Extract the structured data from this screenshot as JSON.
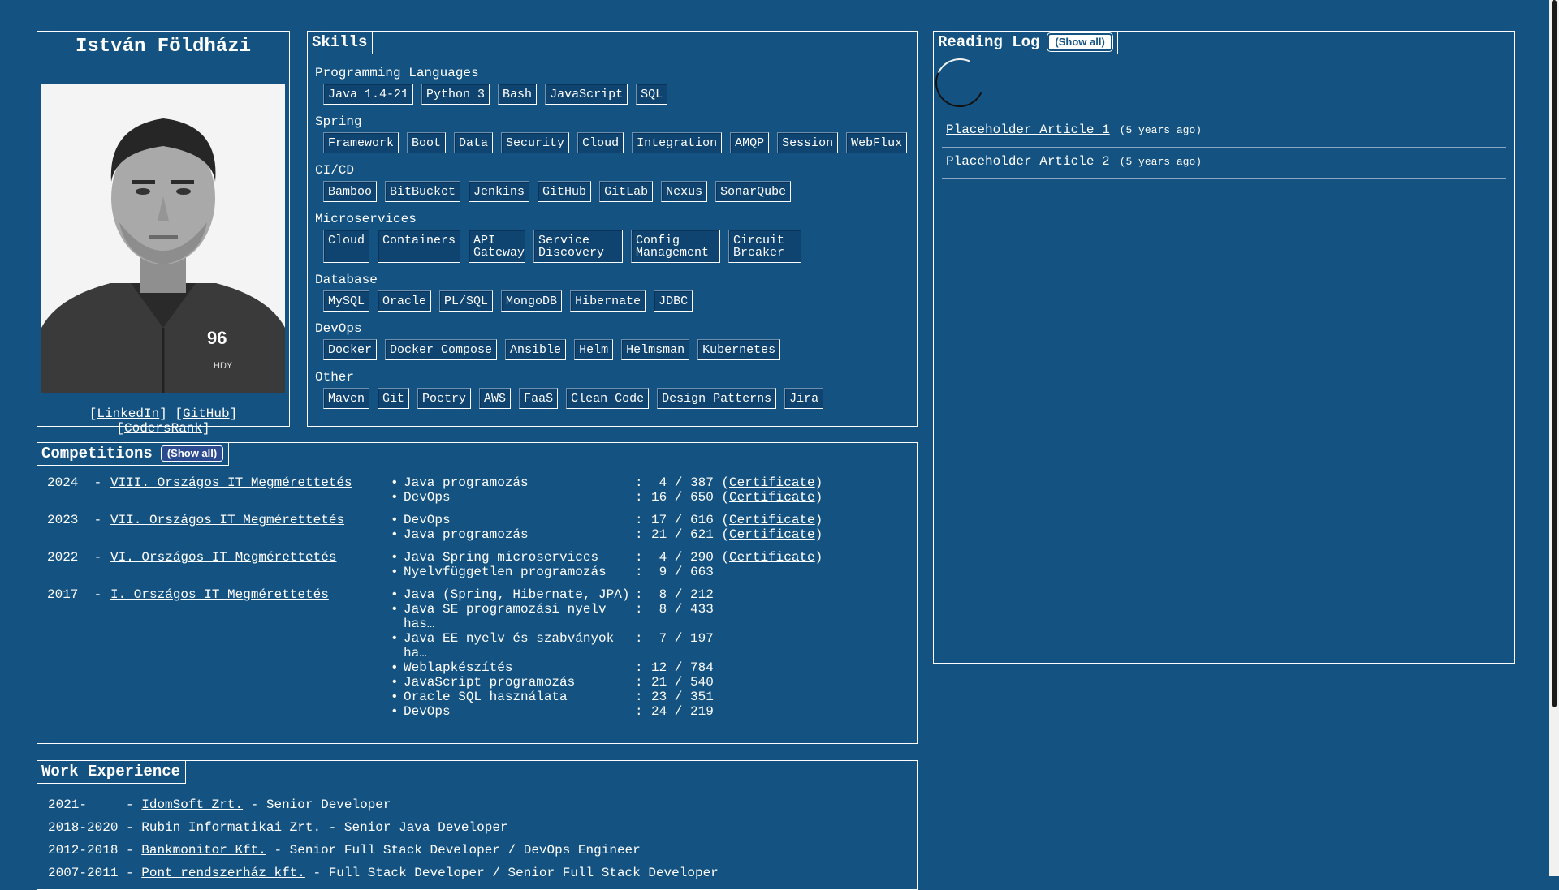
{
  "profile": {
    "name": "István Földházi",
    "photo_text": "96",
    "photo_subtext": "HDY",
    "links": [
      {
        "label": "LinkedIn"
      },
      {
        "label": "GitHub"
      },
      {
        "label": "CodersRank"
      }
    ]
  },
  "skills": {
    "title": "Skills",
    "groups": [
      {
        "name": "Programming Languages",
        "items": [
          "Java 1.4-21",
          "Python 3",
          "Bash",
          "JavaScript",
          "SQL"
        ]
      },
      {
        "name": "Spring",
        "items": [
          "Framework",
          "Boot",
          "Data",
          "Security",
          "Cloud",
          "Integration",
          "AMQP",
          "Session",
          "WebFlux"
        ]
      },
      {
        "name": "CI/CD",
        "items": [
          "Bamboo",
          "BitBucket",
          "Jenkins",
          "GitHub",
          "GitLab",
          "Nexus",
          "SonarQube"
        ]
      },
      {
        "name": "Microservices",
        "items": [
          "Cloud",
          "Containers",
          "API Gateway",
          "Service Discovery",
          "Config Management",
          "Circuit Breaker"
        ]
      },
      {
        "name": "Database",
        "items": [
          "MySQL",
          "Oracle",
          "PL/SQL",
          "MongoDB",
          "Hibernate",
          "JDBC"
        ]
      },
      {
        "name": "DevOps",
        "items": [
          "Docker",
          "Docker Compose",
          "Ansible",
          "Helm",
          "Helmsman",
          "Kubernetes"
        ]
      },
      {
        "name": "Other",
        "items": [
          "Maven",
          "Git",
          "Poetry",
          "AWS",
          "FaaS",
          "Clean Code",
          "Design Patterns",
          "Jira"
        ]
      }
    ]
  },
  "reading_log": {
    "title": "Reading Log",
    "show_all": "(Show all)",
    "articles": [
      {
        "title": "Placeholder Article 1",
        "ago": "(5 years ago)"
      },
      {
        "title": "Placeholder Article 2",
        "ago": "(5 years ago)"
      }
    ]
  },
  "competitions": {
    "title": "Competitions",
    "show_all": "(Show all)",
    "entries": [
      {
        "year": "2024",
        "name": "VIII. Országos IT Megmérettetés",
        "results": [
          {
            "title": "Java programozás",
            "rank": "4",
            "total": "387",
            "certificate": "Certificate"
          },
          {
            "title": "DevOps",
            "rank": "16",
            "total": "650",
            "certificate": "Certificate"
          }
        ]
      },
      {
        "year": "2023",
        "name": "VII. Országos IT Megmérettetés",
        "results": [
          {
            "title": "DevOps",
            "rank": "17",
            "total": "616",
            "certificate": "Certificate"
          },
          {
            "title": "Java programozás",
            "rank": "21",
            "total": "621",
            "certificate": "Certificate"
          }
        ]
      },
      {
        "year": "2022",
        "name": "VI. Országos IT Megmérettetés",
        "results": [
          {
            "title": "Java Spring microservices",
            "rank": "4",
            "total": "290",
            "certificate": "Certificate"
          },
          {
            "title": "Nyelvfüggetlen programozás",
            "rank": "9",
            "total": "663",
            "certificate": ""
          }
        ]
      },
      {
        "year": "2017",
        "name": "I. Országos IT Megmérettetés",
        "results": [
          {
            "title": "Java (Spring, Hibernate, JPA)",
            "rank": "8",
            "total": "212",
            "certificate": ""
          },
          {
            "title": "Java SE programozási nyelv has…",
            "rank": "8",
            "total": "433",
            "certificate": ""
          },
          {
            "title": "Java EE nyelv és szabványok ha…",
            "rank": "7",
            "total": "197",
            "certificate": ""
          },
          {
            "title": "Weblapkészítés",
            "rank": "12",
            "total": "784",
            "certificate": ""
          },
          {
            "title": "JavaScript programozás",
            "rank": "21",
            "total": "540",
            "certificate": ""
          },
          {
            "title": "Oracle SQL használata",
            "rank": "23",
            "total": "351",
            "certificate": ""
          },
          {
            "title": "DevOps",
            "rank": "24",
            "total": "219",
            "certificate": ""
          }
        ]
      }
    ]
  },
  "work": {
    "title": "Work Experience",
    "entries": [
      {
        "period": "2021-    ",
        "company": "IdomSoft Zrt.",
        "role": "Senior Developer"
      },
      {
        "period": "2018-2020",
        "company": "Rubin Informatikai Zrt.",
        "role": "Senior Java Developer"
      },
      {
        "period": "2012-2018",
        "company": "Bankmonitor Kft.",
        "role": "Senior Full Stack Developer / DevOps Engineer"
      },
      {
        "period": "2007-2011",
        "company": "Pont rendszerház kft.",
        "role": "Full Stack Developer / Senior Full Stack Developer"
      }
    ]
  }
}
